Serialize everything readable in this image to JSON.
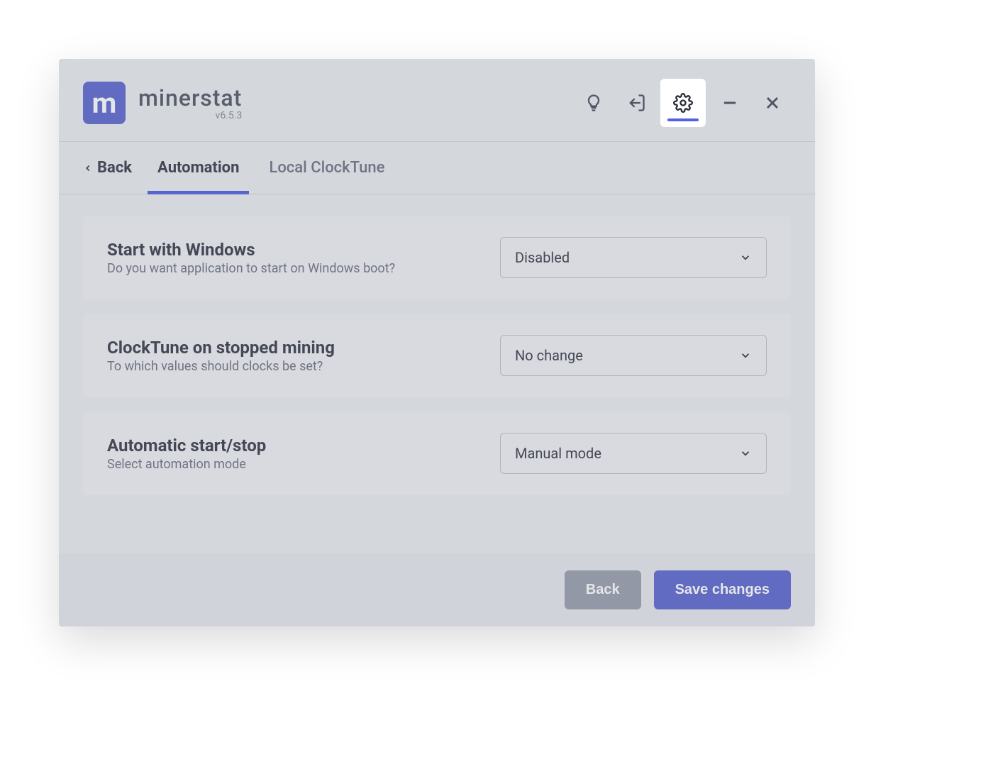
{
  "brand": {
    "name": "minerstat",
    "version": "v6.5.3",
    "logo_letter": "m"
  },
  "header_icons": {
    "help": "help-icon",
    "logout": "logout-icon",
    "settings": "gear-icon",
    "minimize": "minimize-icon",
    "close": "close-icon"
  },
  "tabs": {
    "back_label": "Back",
    "items": [
      {
        "label": "Automation",
        "active": true
      },
      {
        "label": "Local ClockTune",
        "active": false
      }
    ]
  },
  "settings": [
    {
      "title": "Start with Windows",
      "subtitle": "Do you want application to start on Windows boot?",
      "value": "Disabled"
    },
    {
      "title": "ClockTune on stopped mining",
      "subtitle": "To which values should clocks be set?",
      "value": "No change"
    },
    {
      "title": "Automatic start/stop",
      "subtitle": "Select automation mode",
      "value": "Manual mode"
    }
  ],
  "footer": {
    "back": "Back",
    "save": "Save changes"
  }
}
